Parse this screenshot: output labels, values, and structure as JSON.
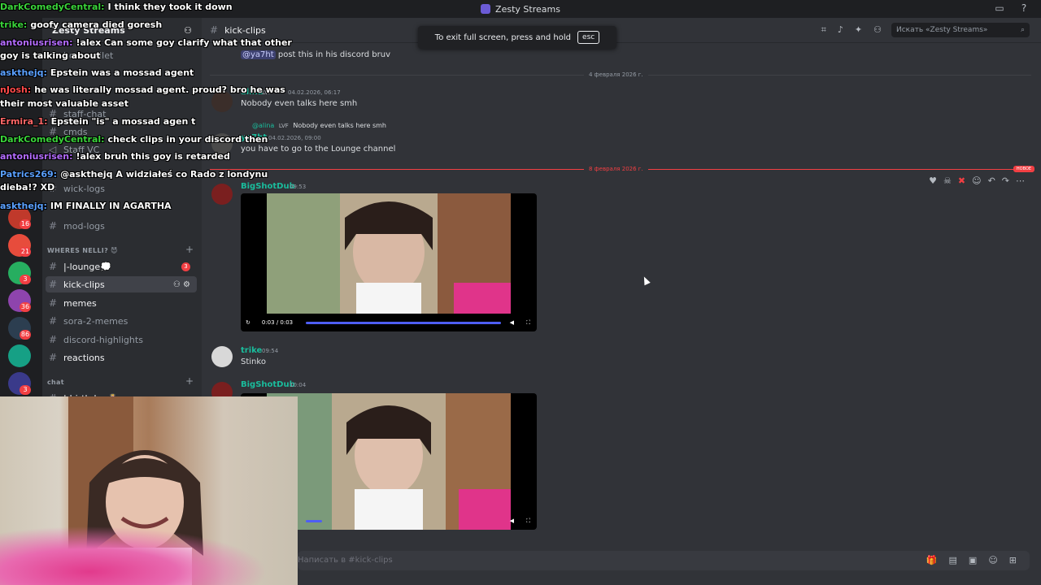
{
  "window": {
    "title": "Zesty Streams"
  },
  "server": {
    "name": "Zesty Streams",
    "search_placeholder": "Искать «Zesty Streams»",
    "rail_badges": [
      "16",
      "21",
      "3",
      "36",
      "86",
      "3"
    ]
  },
  "fullscreen_banner": {
    "text": "To exit full screen, press and hold",
    "key": "esc"
  },
  "sidebar": {
    "channels_top": [
      {
        "name": "hom-wallet"
      },
      {
        "name": "staff-chat"
      },
      {
        "name": "cmds"
      },
      {
        "name": "Staff VC"
      },
      {
        "name": "wick-logs"
      },
      {
        "name": "mod-logs"
      }
    ],
    "category_nelli": "WHERES NELLI? 😈",
    "channels_nelli": [
      {
        "name": "|-lounge💭",
        "badge": "3"
      },
      {
        "name": "kick-clips",
        "active": true
      },
      {
        "name": "memes"
      },
      {
        "name": "sora-2-memes"
      },
      {
        "name": "discord-highlights"
      },
      {
        "name": "reactions"
      }
    ],
    "category_chat": "chat",
    "channel_bottom": "|-birthday🎂"
  },
  "channel": {
    "name": "kick-clips"
  },
  "messages": {
    "top_line": {
      "mention": "@ya7ht",
      "text": "post this in his discord bruv"
    },
    "date1": "4 февраля 2026 г.",
    "m1": {
      "user": "alina",
      "tag": "LVF",
      "time": "04.02.2026, 06:17",
      "text": "Nobody even talks here smh"
    },
    "reply": {
      "user": "@alina",
      "tag": "LVF",
      "text": "Nobody even talks here smh"
    },
    "m2": {
      "user": "ya7ht",
      "time": "04.02.2026, 09:00",
      "text": "you have to go to the Lounge channel"
    },
    "date2": "8 февраля 2026 г.",
    "new_label": "НОВОЕ",
    "m3": {
      "user": "BigShotDub",
      "time": "09:53",
      "video_time": "0:03 / 0:03"
    },
    "m4": {
      "user": "trike",
      "time": "09:54",
      "text": "Stinko"
    },
    "m5": {
      "user": "BigShotDub",
      "time": "10:04"
    }
  },
  "composer": {
    "placeholder": "Написать в #kick-clips"
  },
  "stream_chat": [
    {
      "who": "DarkComedyCentral:",
      "text": "I think they took it down",
      "color": "#3ad33a"
    },
    {
      "who": "trike:",
      "text": "goofy camera died goresh",
      "color": "#3ad33a"
    },
    {
      "who": "antoniusrisen:",
      "text": "!alex Can some goy clarify what that other",
      "color": "#b46cff"
    },
    {
      "who": "",
      "text": "goy is talking about",
      "color": "#ffffff"
    },
    {
      "who": "askthejq:",
      "text": "Epstein was a mossad agent",
      "color": "#5aa0ff"
    },
    {
      "who": "nJosh:",
      "text": "he was literally mossad agent. proud? bro he was",
      "color": "#ff4a4a"
    },
    {
      "who": "",
      "text": "their most valuable asset",
      "color": "#ffffff"
    },
    {
      "who": "Ermira_1:",
      "text": "Epstein \"is\" a mossad agen t",
      "color": "#ff6666"
    },
    {
      "who": "DarkComedyCentral:",
      "text": "check clips in your discord then",
      "color": "#3ad33a"
    },
    {
      "who": "antoniusrisen:",
      "text": "!alex bruh this goy is retarded",
      "color": "#b46cff"
    },
    {
      "who": "Patrics269:",
      "text": "@askthejq A widziałeś co Rado z londynu",
      "color": "#5aa0ff"
    },
    {
      "who": "",
      "text": "dieba!? XD",
      "color": "#ffffff"
    },
    {
      "who": "askthejq:",
      "text": "IM FINALLY IN AGARTHA",
      "color": "#5aa0ff"
    }
  ],
  "colors": {
    "accent": "#5865f2",
    "danger": "#f23f43",
    "username_teal": "#1abc9c"
  }
}
